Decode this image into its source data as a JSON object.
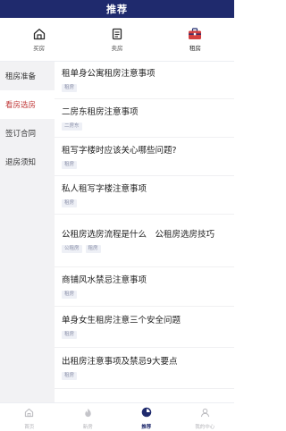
{
  "header": {
    "title": "推荐"
  },
  "top_tabs": [
    {
      "label": "买房",
      "icon": "house-icon"
    },
    {
      "label": "卖房",
      "icon": "document-icon"
    },
    {
      "label": "租房",
      "icon": "suitcase-icon",
      "active": true
    }
  ],
  "sidebar": {
    "items": [
      {
        "label": "租房准备"
      },
      {
        "label": "看房选房",
        "active": true
      },
      {
        "label": "签订合同"
      },
      {
        "label": "退房须知"
      }
    ]
  },
  "articles": [
    {
      "title": "租单身公寓租房注意事项",
      "tags": [
        "租房"
      ]
    },
    {
      "title": "二房东租房注意事项",
      "tags": [
        "二房东"
      ]
    },
    {
      "title": "租写字楼时应该关心哪些问题?",
      "tags": [
        "租房"
      ]
    },
    {
      "title": "私人租写字楼注意事项",
      "tags": [
        "租房"
      ]
    },
    {
      "title": "公租房选房流程是什么　公租房选房技巧",
      "tags": [
        "公租房",
        "租房"
      ]
    },
    {
      "title": "商铺风水禁忌注意事项",
      "tags": [
        "租房"
      ]
    },
    {
      "title": "单身女生租房注意三个安全问题",
      "tags": [
        "租房"
      ]
    },
    {
      "title": "出租房注意事项及禁忌9大要点",
      "tags": [
        "租房"
      ]
    }
  ],
  "bottom_nav": [
    {
      "label": "首页",
      "icon": "home-icon"
    },
    {
      "label": "新房",
      "icon": "fire-icon"
    },
    {
      "label": "推荐",
      "icon": "recommend-icon",
      "active": true
    },
    {
      "label": "我的中心",
      "icon": "user-icon"
    }
  ],
  "colors": {
    "primary": "#1f2a6d",
    "sidebar_active_text": "#c13b3b",
    "suitcase": "#d43f3f"
  }
}
